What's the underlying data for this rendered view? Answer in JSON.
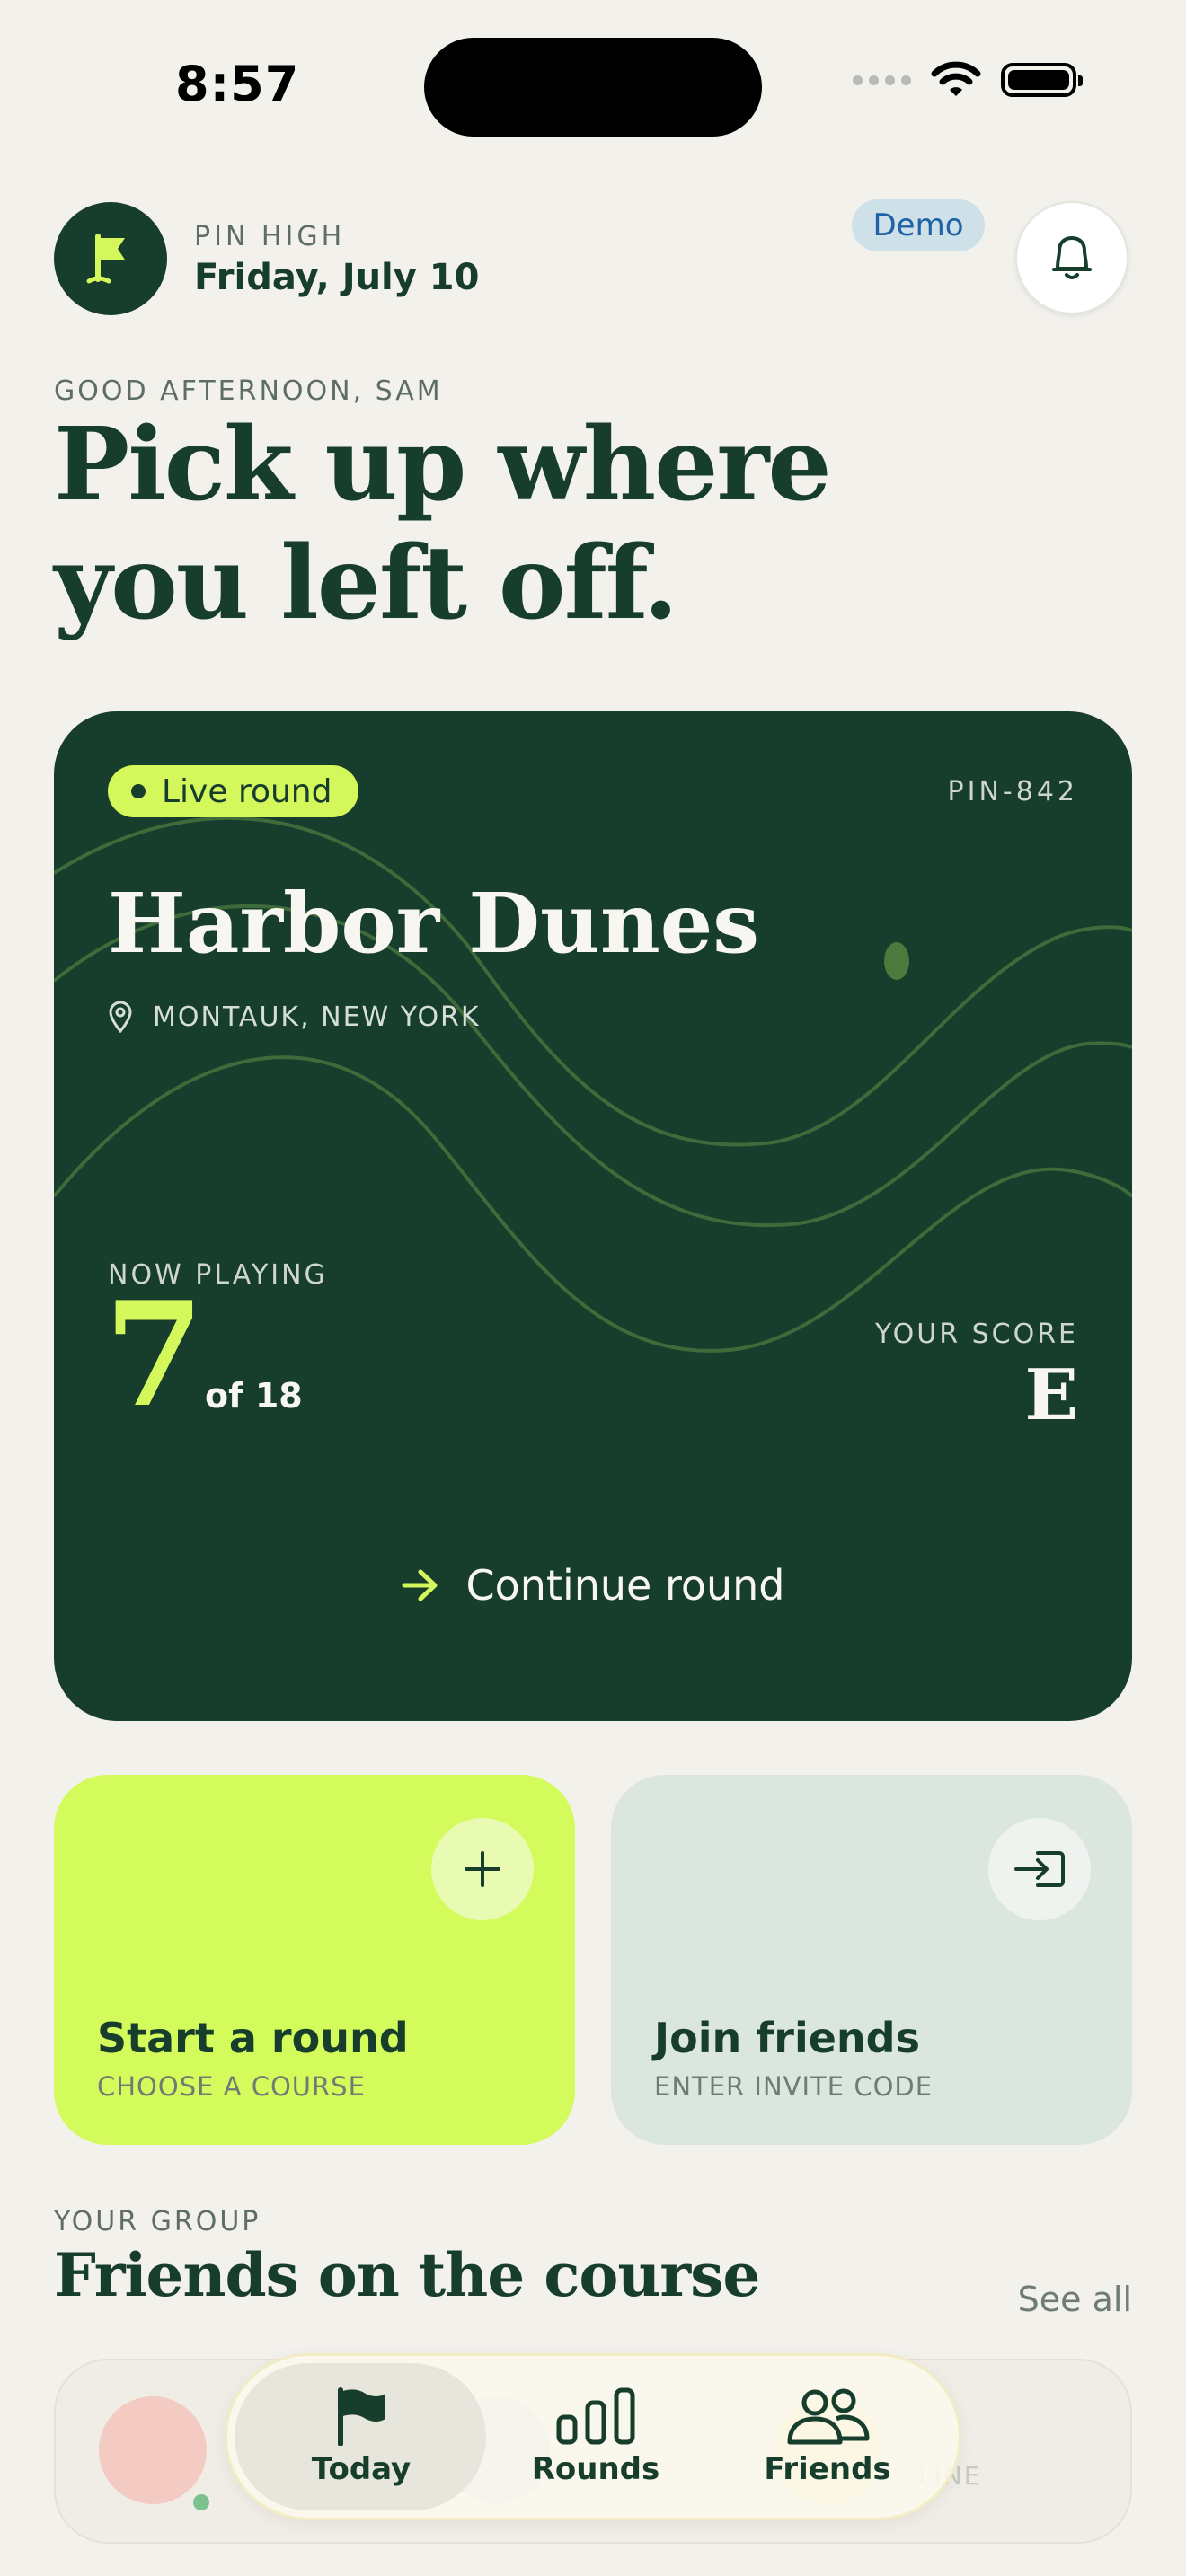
{
  "status_bar": {
    "time": "8:57"
  },
  "header": {
    "brand": "PIN HIGH",
    "date": "Friday, July 10",
    "demo_badge": "Demo"
  },
  "greeting": {
    "label": "GOOD AFTERNOON, SAM",
    "headline_line1": "Pick up where",
    "headline_line2": "you left off."
  },
  "live_round": {
    "badge": "Live round",
    "code": "PIN-842",
    "course": "Harbor Dunes",
    "location": "MONTAUK, NEW YORK",
    "now_playing_label": "NOW PLAYING",
    "hole": "7",
    "hole_total": "of 18",
    "score_label": "YOUR SCORE",
    "score": "E",
    "continue_label": "Continue round"
  },
  "actions": {
    "start": {
      "title": "Start a round",
      "subtitle": "CHOOSE A COURSE"
    },
    "join": {
      "title": "Join friends",
      "subtitle": "ENTER INVITE CODE"
    }
  },
  "group": {
    "label": "YOUR GROUP",
    "title": "Friends on the course",
    "see_all": "See all",
    "status_text": "LINE"
  },
  "tabs": [
    {
      "label": "Today",
      "icon": "flag-icon",
      "active": true
    },
    {
      "label": "Rounds",
      "icon": "bar-chart-icon",
      "active": false
    },
    {
      "label": "Friends",
      "icon": "people-icon",
      "active": false
    }
  ],
  "colors": {
    "forest": "#173d2c",
    "lime": "#d4f75b",
    "background": "#f3f1ec",
    "demo_text": "#2062a8"
  }
}
